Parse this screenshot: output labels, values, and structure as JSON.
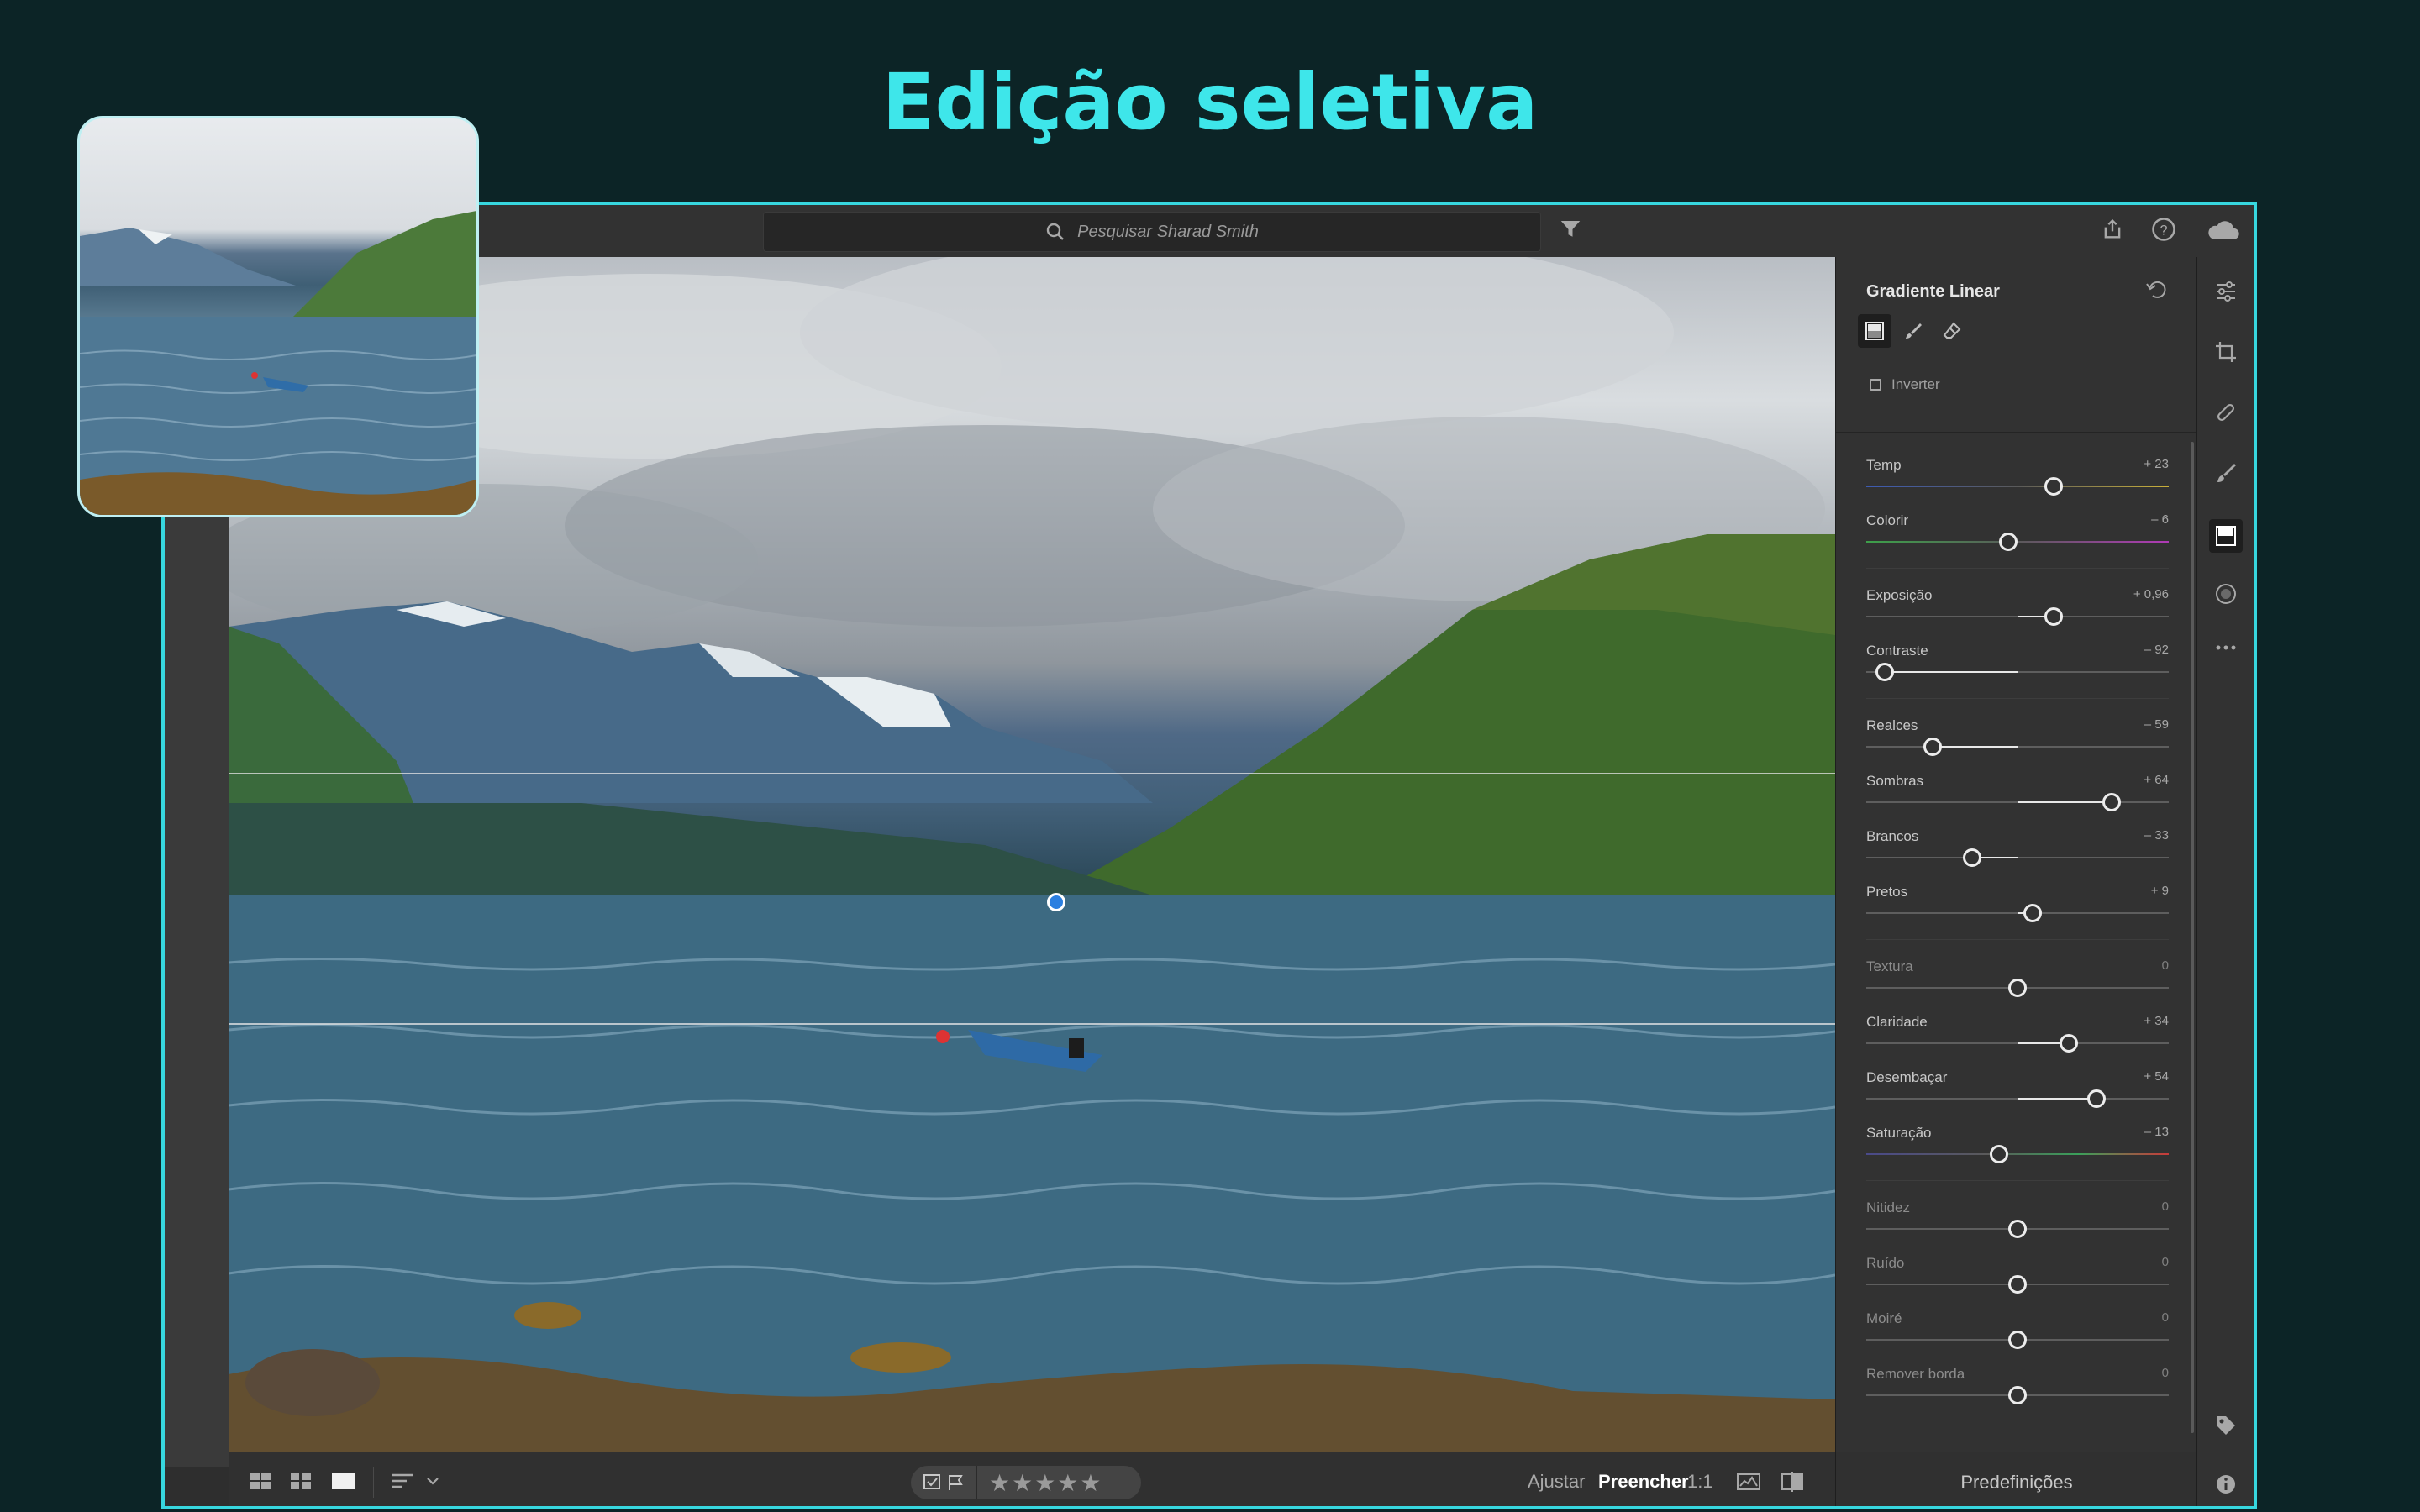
{
  "headline": "Edição seletiva",
  "search": {
    "placeholder": "Pesquisar Sharad Smith"
  },
  "topbar_icons": [
    "filter-icon",
    "share-icon",
    "help-icon",
    "cloud-icon"
  ],
  "panel": {
    "title": "Gradiente Linear",
    "tools": [
      "gradient-tool-icon",
      "brush-tool-icon",
      "eraser-tool-icon"
    ],
    "invert_label": "Inverter",
    "invert_checked": false,
    "sliders": [
      {
        "label": "Temp",
        "value": "+ 23",
        "pos": 0.62,
        "fill": "grad-temp"
      },
      {
        "label": "Colorir",
        "value": "– 6",
        "pos": 0.47,
        "fill": "grad-tint"
      },
      {
        "label": "Exposição",
        "value": "+ 0,96",
        "pos": 0.62
      },
      {
        "label": "Contraste",
        "value": "– 92",
        "pos": 0.06
      },
      {
        "label": "Realces",
        "value": "– 59",
        "pos": 0.22
      },
      {
        "label": "Sombras",
        "value": "+ 64",
        "pos": 0.81
      },
      {
        "label": "Brancos",
        "value": "– 33",
        "pos": 0.35
      },
      {
        "label": "Pretos",
        "value": "+ 9",
        "pos": 0.55
      },
      {
        "label": "Textura",
        "value": "0",
        "pos": 0.5,
        "dim": true
      },
      {
        "label": "Claridade",
        "value": "+ 34",
        "pos": 0.67
      },
      {
        "label": "Desembaçar",
        "value": "+ 54",
        "pos": 0.76
      },
      {
        "label": "Saturação",
        "value": "– 13",
        "pos": 0.44,
        "fill": "grad-sat"
      },
      {
        "label": "Nitidez",
        "value": "0",
        "pos": 0.5,
        "dim": true
      },
      {
        "label": "Ruído",
        "value": "0",
        "pos": 0.5,
        "dim": true
      },
      {
        "label": "Moiré",
        "value": "0",
        "pos": 0.5,
        "dim": true
      },
      {
        "label": "Remover borda",
        "value": "0",
        "pos": 0.5,
        "dim": true
      }
    ],
    "footer": "Predefinições"
  },
  "bottombar": {
    "ajustar": "Ajustar",
    "preencher": "Preencher",
    "one_to_one": "1:1",
    "stars": "★★★★★",
    "view_icons": [
      "square-grid-icon",
      "grid-icon",
      "single-view-icon",
      "sort-icon",
      "chevron-down-icon"
    ]
  },
  "rightbar_icons": [
    "sliders-icon",
    "crop-icon",
    "healing-icon",
    "brush-icon",
    "linear-gradient-icon",
    "radial-gradient-icon",
    "more-icon",
    "tag-icon",
    "info-icon"
  ]
}
